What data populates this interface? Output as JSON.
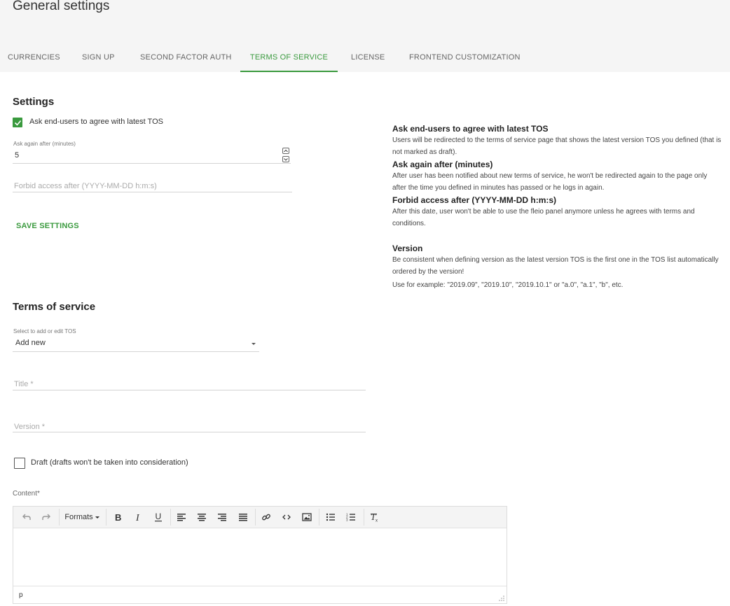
{
  "page": {
    "title": "General settings"
  },
  "tabs": [
    {
      "label": "CURRENCIES"
    },
    {
      "label": "SIGN UP"
    },
    {
      "label": "SECOND FACTOR AUTH"
    },
    {
      "label": "TERMS OF SERVICE",
      "active": true
    },
    {
      "label": "LICENSE"
    },
    {
      "label": "FRONTEND CUSTOMIZATION"
    }
  ],
  "settings": {
    "heading": "Settings",
    "ask_agree": {
      "label": "Ask end-users to agree with latest TOS",
      "checked": true
    },
    "ask_again": {
      "label": "Ask again after (minutes)",
      "value": "5"
    },
    "forbid": {
      "placeholder": "Forbid access after (YYYY-MM-DD h:m:s)"
    },
    "save_label": "SAVE SETTINGS"
  },
  "help": {
    "ask_title": "Ask end-users to agree with latest TOS",
    "ask_text": "Users will be redirected to the terms of service page that shows the latest version TOS you defined (that is not marked as draft).",
    "again_title": "Ask again after (minutes)",
    "again_text": "After user has been notified about new terms of service, he won't be redirected again to the page only after the time you defined in minutes has passed or he logs in again.",
    "forbid_title": "Forbid access after (YYYY-MM-DD h:m:s)",
    "forbid_text": "After this date, user won't be able to use the fleio panel anymore unless he agrees with terms and conditions.",
    "version_title": "Version",
    "version_text1": "Be consistent when defining version as the latest version TOS is the first one in the TOS list automatically ordered by the version!",
    "version_text2": "Use for example: \"2019.09\", \"2019.10\", \"2019.10.1\" or \"a.0\", \"a.1\", \"b\", etc."
  },
  "tos": {
    "heading": "Terms of service",
    "select_label": "Select to add or edit TOS",
    "select_value": "Add new",
    "title_placeholder": "Title *",
    "version_placeholder": "Version *",
    "draft_label": "Draft (drafts won't be taken into consideration)",
    "draft_checked": false,
    "content_label": "Content*"
  },
  "editor": {
    "formats_label": "Formats",
    "status_path": "p",
    "toolbar_icons": [
      "undo-icon",
      "redo-icon",
      "bold-icon",
      "italic-icon",
      "underline-icon",
      "align-left-icon",
      "align-center-icon",
      "align-right-icon",
      "align-justify-icon",
      "link-icon",
      "code-icon",
      "image-icon",
      "bullet-list-icon",
      "numbered-list-icon",
      "clear-format-icon"
    ],
    "accent_color": "#3a9a3e"
  }
}
